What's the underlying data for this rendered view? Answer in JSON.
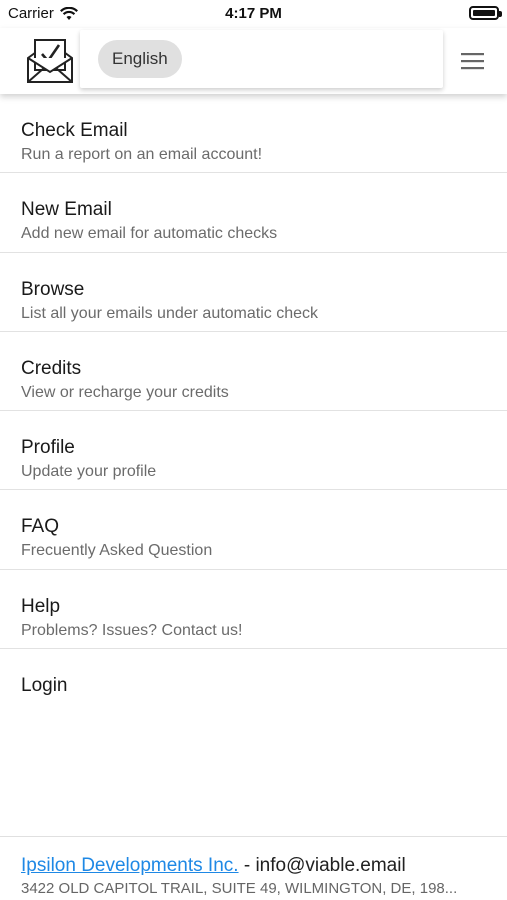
{
  "status_bar": {
    "carrier": "Carrier",
    "time": "4:17 PM"
  },
  "header": {
    "language": "English",
    "logo_icon": "envelope-check-icon",
    "menu_icon": "hamburger-menu-icon"
  },
  "menu": {
    "items": [
      {
        "title": "Check Email",
        "subtitle": "Run a report on an email account!"
      },
      {
        "title": "New Email",
        "subtitle": "Add new email for automatic checks"
      },
      {
        "title": "Browse",
        "subtitle": "List all your emails under automatic check"
      },
      {
        "title": "Credits",
        "subtitle": "View or recharge your credits"
      },
      {
        "title": "Profile",
        "subtitle": "Update your profile"
      },
      {
        "title": "FAQ",
        "subtitle": "Frecuently Asked Question"
      },
      {
        "title": "Help",
        "subtitle": "Problems? Issues? Contact us!"
      },
      {
        "title": "Login"
      }
    ]
  },
  "footer": {
    "company": "Ipsilon Developments Inc.",
    "separator_email": " - info@viable.email",
    "address": "3422 OLD CAPITOL TRAIL, SUITE 49, WILMINGTON, DE, 198..."
  },
  "colors": {
    "link": "#1e88e5",
    "chip_bg": "#e0e0e0"
  }
}
